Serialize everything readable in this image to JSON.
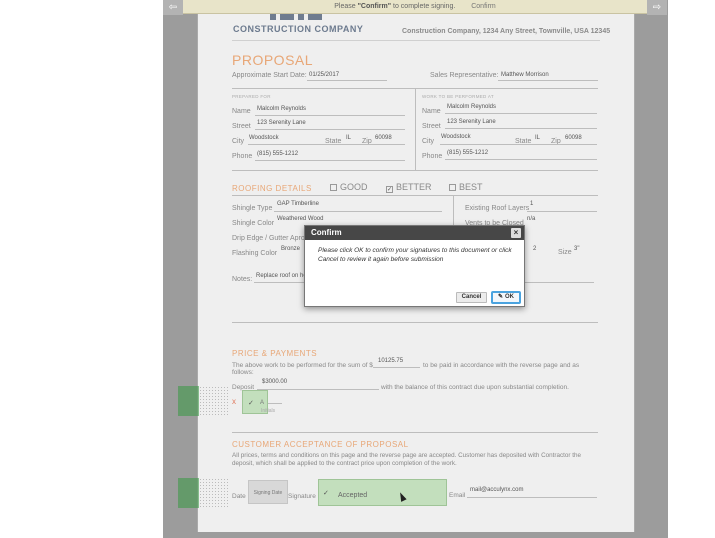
{
  "banner": {
    "message_pre": "Please ",
    "message_bold": "\"Confirm\"",
    "message_post": " to complete signing.",
    "confirm_link": "Confirm"
  },
  "nav": {
    "prev_icon": "⇦",
    "next_icon": "⇨"
  },
  "header": {
    "company": "CONSTRUCTION COMPANY",
    "address": "Construction Company, 1234 Any Street, Townville, USA 12345"
  },
  "proposal": {
    "title": "PROPOSAL",
    "start_date_label": "Approximate Start Date:",
    "start_date": "01/25/2017",
    "rep_label": "Sales Representative:",
    "rep": "Matthew Morrison",
    "prepared_for_label": "PREPARED FOR",
    "work_at_label": "WORK TO BE PERFORMED AT",
    "name_label": "Name",
    "street_label": "Street",
    "city_label": "City",
    "state_label": "State",
    "zip_label": "Zip",
    "phone_label": "Phone",
    "left": {
      "name": "Malcolm Reynolds",
      "street": "123 Serenity Lane",
      "city": "Woodstock",
      "state": "IL",
      "zip": "60098",
      "phone": "(815) 555-1212"
    },
    "right": {
      "name": "Malcolm Reynolds",
      "street": "123 Serenity Lane",
      "city": "Woodstock",
      "state": "IL",
      "zip": "60098",
      "phone": "(815) 555-1212"
    }
  },
  "roofing": {
    "section": "ROOFING DETAILS",
    "options": [
      {
        "label": "GOOD",
        "checked": ""
      },
      {
        "label": "BETTER",
        "checked": "✓"
      },
      {
        "label": "BEST",
        "checked": ""
      }
    ],
    "shingle_type_label": "Shingle Type",
    "shingle_type": "GAP Timberline",
    "shingle_color_label": "Shingle Color",
    "shingle_color": "Weathered Wood",
    "drip_edge_label": "Drip Edge / Gutter Apron",
    "flashing_label": "Flashing Color",
    "flashing": "Bronze",
    "layers_label": "Existing Roof Layers",
    "layers": "1",
    "vents_label": "Vents to be Closed",
    "vents": "n/a",
    "qty_value": "2",
    "size_label": "Size",
    "size": "3\"",
    "notes_label": "Notes:",
    "notes": "Replace roof on house."
  },
  "price": {
    "section": "PRICE & PAYMENTS",
    "text1": "The above work to be performed for the sum of $",
    "amount": "10125.75",
    "text2": "to be paid in accordance with the reverse page and as",
    "text3": "follows:",
    "deposit_label": "Deposit",
    "deposit": "$3000.00",
    "balance_text": "with the balance of this contract due upon substantial completion.",
    "x_mark": "x",
    "initials_check": "✓",
    "initials_text": "A",
    "initials_caption": "Initials"
  },
  "acceptance": {
    "section": "CUSTOMER ACCEPTANCE OF PROPOSAL",
    "text": "All prices, terms and conditions on this page and the reverse page are accepted. Customer has deposited with Contractor the deposit, which shall be applied to the contract price upon completion of the work.",
    "date_label": "Date",
    "signing_date": "Signing Date",
    "signature_label": "Signature",
    "signature_check": "✓",
    "signature_text": "Accepted",
    "email_label": "Email",
    "email": "mail@acculynx.com"
  },
  "dialog": {
    "title": "Confirm",
    "close_icon": "×",
    "message": "Please click OK to confirm your signatures to this document or click Cancel to review it again before submission",
    "cancel_label": "Cancel",
    "ok_icon": "✎",
    "ok_label": "OK"
  }
}
